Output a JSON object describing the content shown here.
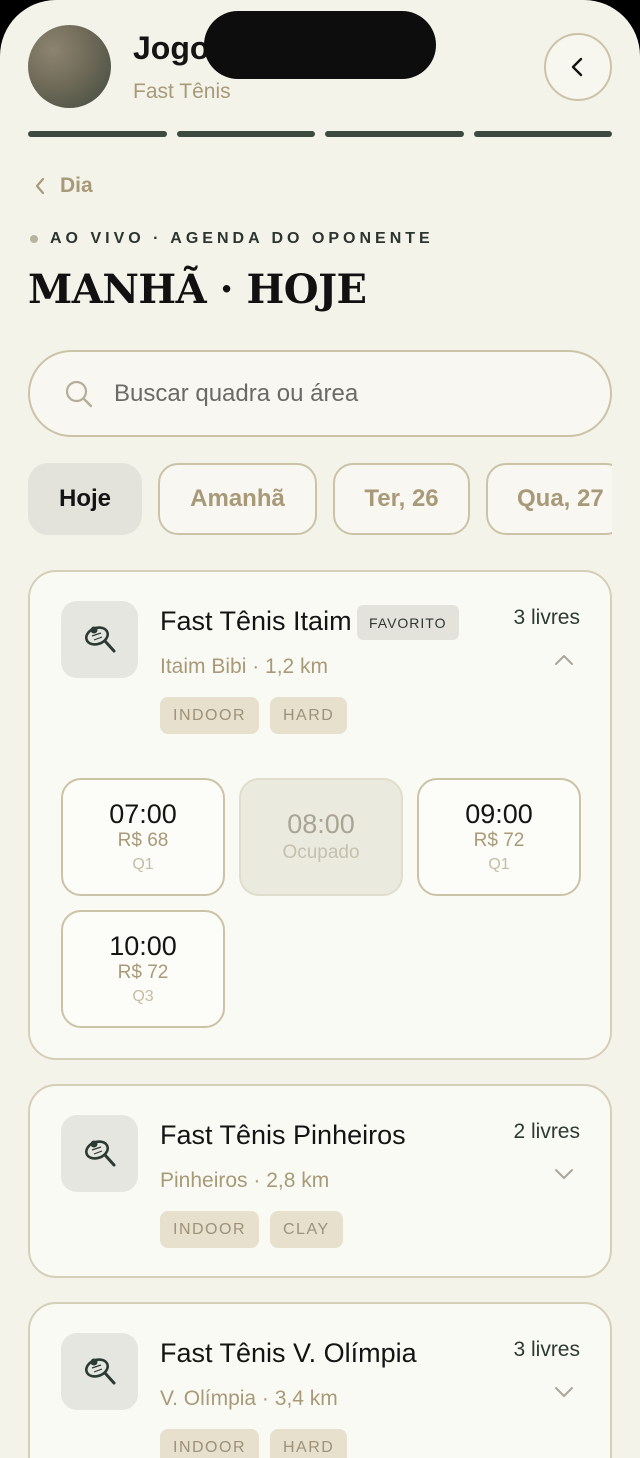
{
  "header": {
    "title": "Jogo",
    "subtitle": "Fast Tênis",
    "progress_steps": 4
  },
  "back_link": {
    "label": "Dia"
  },
  "eyebrow": "AO VIVO · AGENDA DO OPONENTE",
  "page_title": "MANHÃ · HOJE",
  "search": {
    "placeholder": "Buscar quadra ou área",
    "value": ""
  },
  "day_chips": [
    {
      "label": "Hoje",
      "selected": true
    },
    {
      "label": "Amanhã",
      "selected": false
    },
    {
      "label": "Ter, 26",
      "selected": false
    },
    {
      "label": "Qua, 27",
      "selected": false
    }
  ],
  "venues": [
    {
      "name": "Fast Tênis Itaim",
      "badge": "FAVORITO",
      "location": "Itaim Bibi · 1,2 km",
      "free": "3 livres",
      "expanded": true,
      "tags": [
        "INDOOR",
        "HARD"
      ],
      "slots": [
        {
          "time": "07:00",
          "price": "R$ 68",
          "court": "Q1",
          "available": true
        },
        {
          "time": "08:00",
          "status": "Ocupado",
          "available": false
        },
        {
          "time": "09:00",
          "price": "R$ 72",
          "court": "Q1",
          "available": true
        },
        {
          "time": "10:00",
          "price": "R$ 72",
          "court": "Q3",
          "available": true
        }
      ]
    },
    {
      "name": "Fast Tênis Pinheiros",
      "location": "Pinheiros · 2,8 km",
      "free": "2 livres",
      "expanded": false,
      "tags": [
        "INDOOR",
        "CLAY"
      ]
    },
    {
      "name": "Fast Tênis V. Olímpia",
      "location": "V. Olímpia · 3,4 km",
      "free": "3 livres",
      "expanded": false,
      "tags": [
        "INDOOR",
        "HARD"
      ]
    }
  ],
  "colors": {
    "accent": "#a89a78",
    "dark": "#3d4a40",
    "background": "#f4f3ea"
  },
  "icons": {
    "close": "chevron-left-icon",
    "search": "search-icon",
    "court": "tennis-racket-icon"
  }
}
